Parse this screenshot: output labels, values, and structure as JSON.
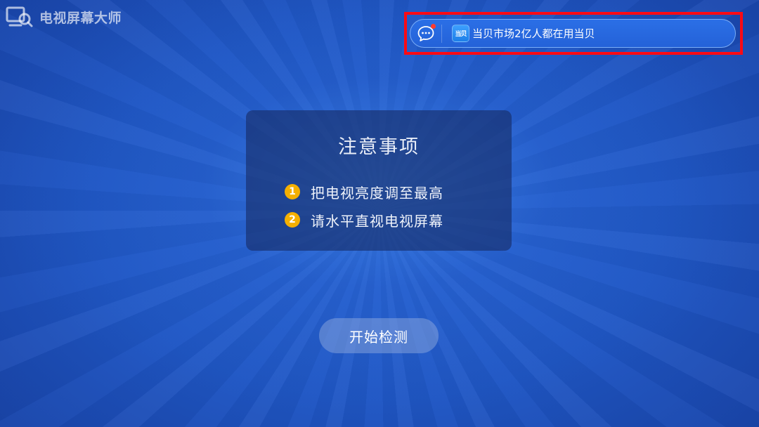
{
  "app": {
    "name": "电视屏幕大师",
    "logo_icon": "tv-search-icon"
  },
  "ad_bar": {
    "chat_icon": "chat-bubble-icon",
    "app_icon_label": "当贝",
    "text": "当贝市场2亿人都在用当贝",
    "dot_color": "#ff3b30",
    "highlight_color": "#ff0a14"
  },
  "notice": {
    "title": "注意事项",
    "items": [
      {
        "number": "1",
        "text": "把电视亮度调至最高"
      },
      {
        "number": "2",
        "text": "请水平直视电视屏幕"
      }
    ],
    "badge_color": "#f5b000"
  },
  "start_button": {
    "label": "开始检测"
  }
}
